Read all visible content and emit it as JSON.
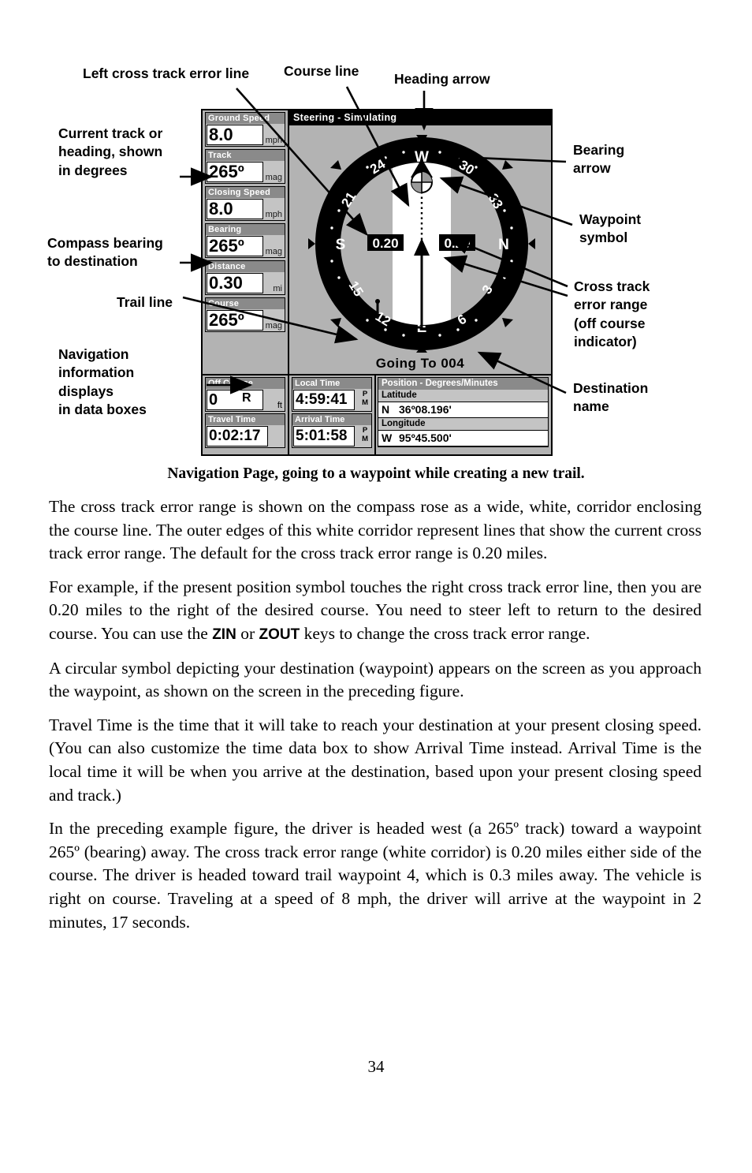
{
  "callouts": {
    "left_xte": "Left cross track error line",
    "course_line": "Course line",
    "heading_arrow": "Heading arrow",
    "current_track": "Current track or\nheading, shown\nin degrees",
    "compass_bearing": "Compass bearing\nto destination",
    "trail_line": "Trail line",
    "nav_info": "Navigation\ninformation\ndisplays\nin data boxes",
    "bearing_arrow": "Bearing\narrow",
    "waypoint_symbol": "Waypoint\nsymbol",
    "cross_track": "Cross track\nerror range\n(off course\nindicator)",
    "destination_name": "Destination\nname"
  },
  "device": {
    "titlebar": "Steering - Simulating",
    "destination": "Going To 004",
    "left_boxes": [
      {
        "label": "Ground Speed",
        "value": "8.0",
        "unit": "mph"
      },
      {
        "label": "Track",
        "value": "265º",
        "unit": "mag"
      },
      {
        "label": "Closing Speed",
        "value": "8.0",
        "unit": "mph"
      },
      {
        "label": "Bearing",
        "value": "265º",
        "unit": "mag"
      },
      {
        "label": "Distance",
        "value": "0.30",
        "unit": "mi"
      },
      {
        "label": "Course",
        "value": "265º",
        "unit": "mag"
      }
    ],
    "bottom_boxes": [
      {
        "label": "Off Course",
        "value": "0",
        "side": "R",
        "unit": "ft"
      },
      {
        "label": "Travel Time",
        "value": "0:02:17",
        "unit": ""
      },
      {
        "label": "Local Time",
        "value": "4:59:41",
        "meridiem": "PM"
      },
      {
        "label": "Arrival Time",
        "value": "5:01:58",
        "meridiem": "PM"
      }
    ],
    "position": {
      "header": "Position - Degrees/Minutes",
      "lat_label": "Latitude",
      "lat_hemi": "N",
      "lat_value": "36º08.196'",
      "lon_label": "Longitude",
      "lon_hemi": "W",
      "lon_value": "95º45.500'"
    },
    "compass": {
      "cardinals": [
        "W",
        "N",
        "E",
        "S"
      ],
      "ticks": [
        "24",
        "21",
        "15",
        "12",
        "6",
        "3",
        "33",
        "30"
      ],
      "xte_left_label": "0.20",
      "xte_right_label": "0.20"
    }
  },
  "caption": "Navigation Page, going to a waypoint while creating a new trail.",
  "body": {
    "p1": "The cross track error range is shown on the compass rose as a wide, white, corridor enclosing the course line. The outer edges of this white corridor represent lines that show the current cross track error range. The default for the cross track error range is 0.20 miles.",
    "p2a": "For example, if the present position symbol touches the right cross track error line, then you are 0.20 miles to the right of the desired course. You need to steer left to return to the desired course. You can use the ",
    "p2_key1": "ZIN",
    "p2b": " or ",
    "p2_key2": "ZOUT",
    "p2c": " keys to change the cross track error range.",
    "p3": "A circular symbol depicting your destination (waypoint) appears on the screen as you approach the waypoint, as shown on the screen in the preceding figure.",
    "p4": "Travel Time is the time that it will take to reach your destination at your present closing speed. (You can also customize the time data box to show Arrival Time instead. Arrival Time is the local time it will be when you arrive at the destination, based upon your present closing speed and track.)",
    "p5": "In the preceding example figure, the driver is headed west (a 265º track) toward a waypoint 265º (bearing) away. The cross track error range (white corridor) is 0.20 miles either side of the course. The driver is headed toward trail waypoint 4, which is 0.3 miles away. The vehicle is right on course. Traveling at a speed of 8 mph, the driver will arrive at the waypoint in 2 minutes, 17 seconds."
  },
  "page_number": "34"
}
